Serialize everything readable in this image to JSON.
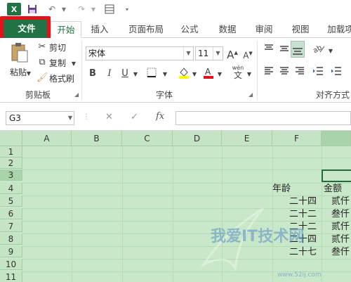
{
  "qat": {
    "logo": "X",
    "save_icon": "save-icon",
    "undo_icon": "undo-icon",
    "redo_icon": "redo-icon",
    "form_icon": "form-icon"
  },
  "tabs": [
    "文件",
    "开始",
    "插入",
    "页面布局",
    "公式",
    "数据",
    "审阅",
    "视图",
    "加载项"
  ],
  "ribbon": {
    "clipboard": {
      "paste": "粘贴",
      "cut": "剪切",
      "copy": "复制",
      "format_painter": "格式刷",
      "label": "剪贴板"
    },
    "font": {
      "name": "宋体",
      "size": "11",
      "label": "字体",
      "grow": "A",
      "shrink": "A",
      "bold": "B",
      "italic": "I",
      "underline": "U",
      "wen": "wén",
      "wen_char": "文"
    },
    "alignment": {
      "label": "对齐方式"
    }
  },
  "formula_bar": {
    "name_box": "G3",
    "fx": "fx",
    "value": ""
  },
  "grid": {
    "columns": [
      "A",
      "B",
      "C",
      "D",
      "E",
      "F"
    ],
    "selected_column": "G",
    "rows": [
      "1",
      "2",
      "3",
      "4",
      "5",
      "6",
      "7",
      "8",
      "9",
      "10",
      "11"
    ],
    "selected_row": "3",
    "selected_cell": "G3",
    "cells": {
      "F4": "年龄",
      "G4": "金额",
      "F5": "二十四",
      "G5": "贰仟",
      "F6": "二十二",
      "G6": "叁仟",
      "F7": "二十二",
      "G7": "贰仟",
      "F8": "二十四",
      "G8": "贰仟",
      "F9": "二十七",
      "G9": "叁仟"
    }
  },
  "watermark": {
    "text": "我爱IT技术网",
    "url": "www.52ij.com"
  },
  "colors": {
    "accent": "#217346",
    "highlight": "#e3111a",
    "grid_bg": "#c9e8c9"
  }
}
